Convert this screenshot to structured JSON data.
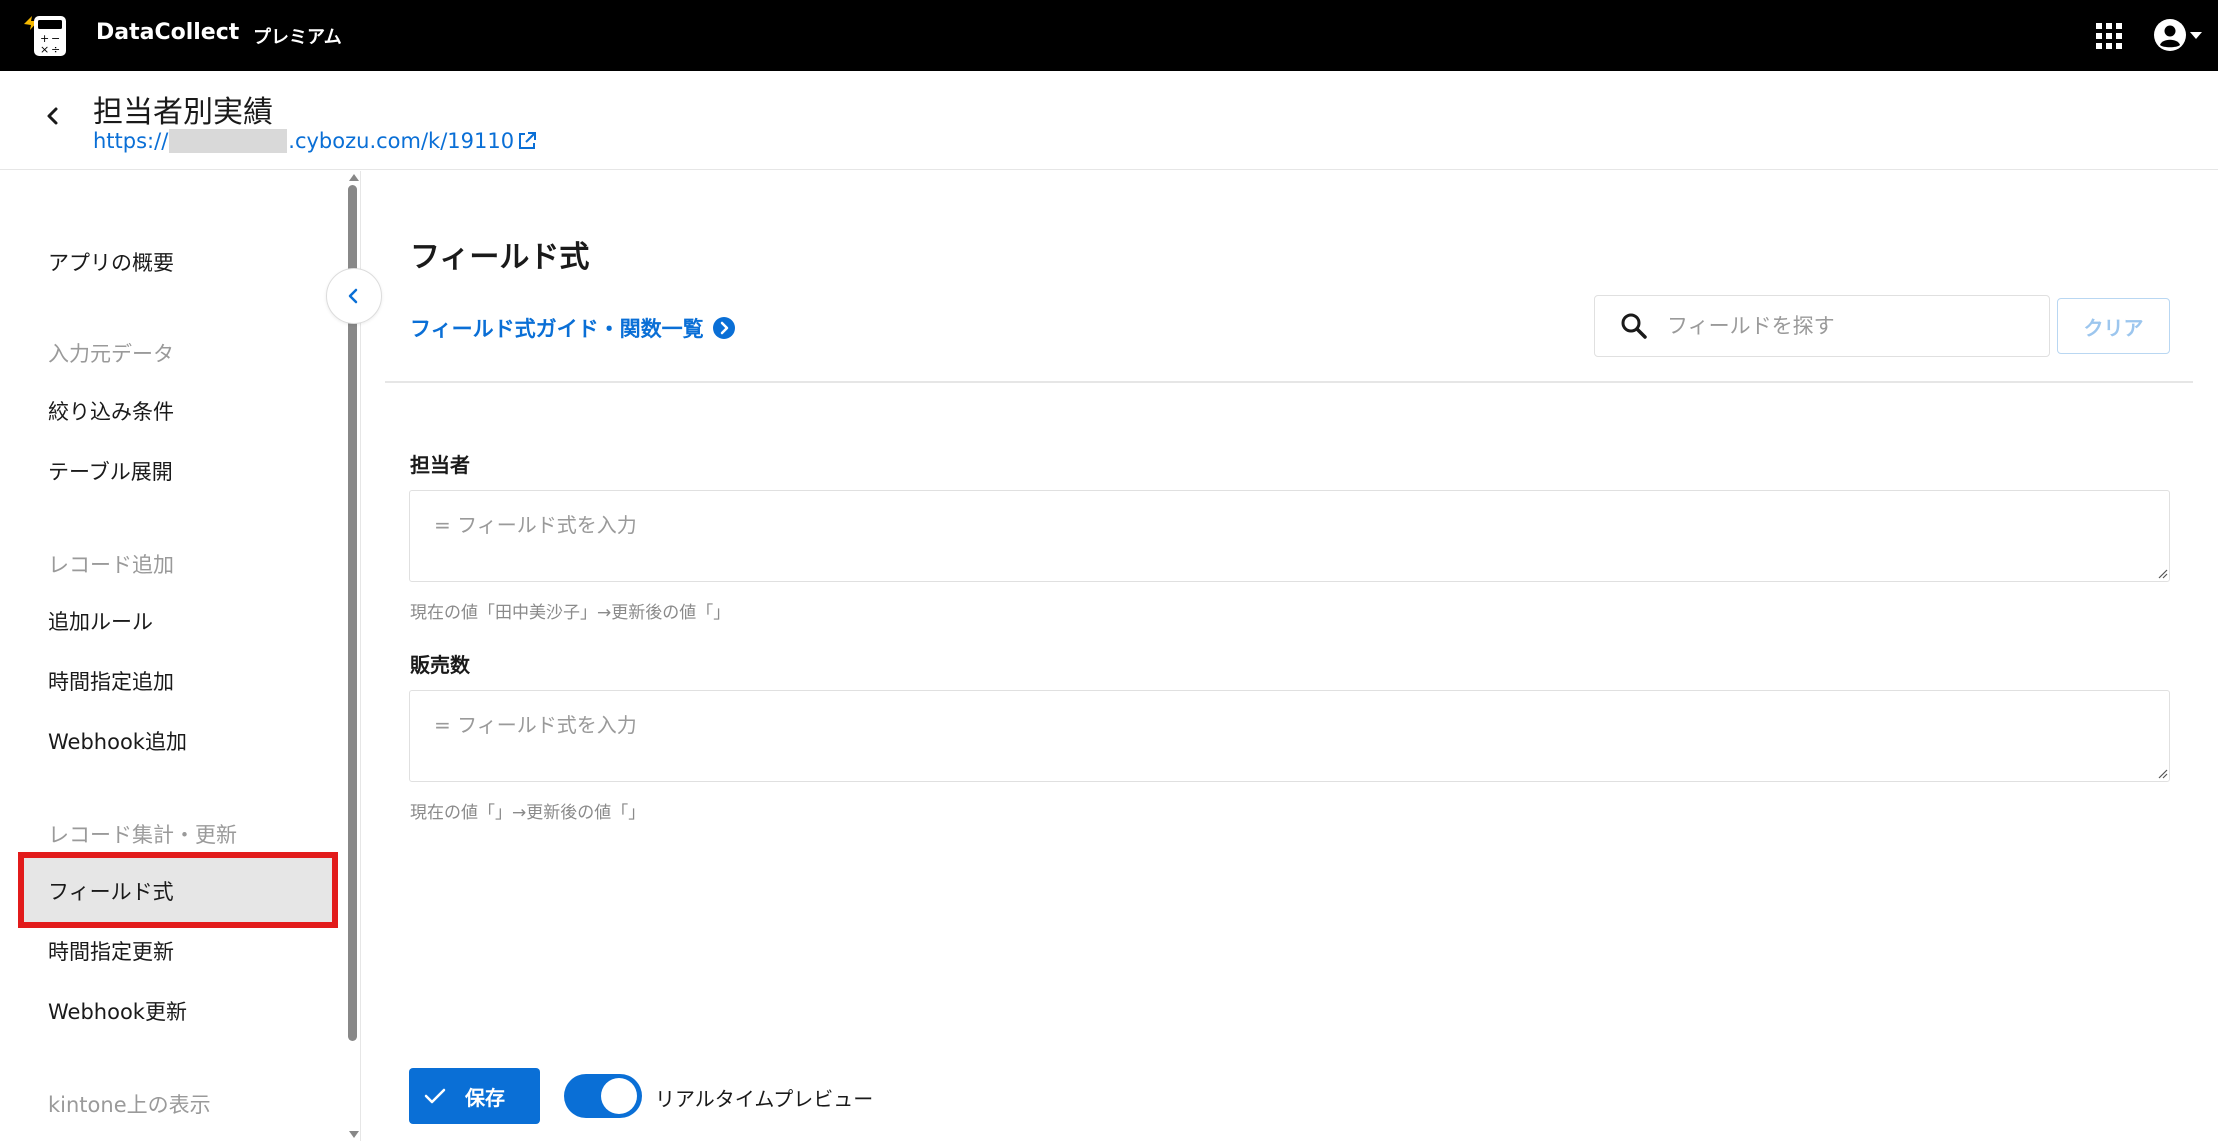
{
  "topbar": {
    "brand": "DataCollect",
    "plan": "プレミアム",
    "apps_icon": "grid-apps-icon",
    "user_icon": "account-circle-icon",
    "colors": {
      "background": "#000000",
      "text": "#ffffff"
    }
  },
  "header": {
    "title": "担当者別実績",
    "url_prefix": "https://",
    "url_suffix": ".cybozu.com/k/19110",
    "back_icon": "chevron-left-icon",
    "external_icon": "external-link-icon"
  },
  "sidebar": {
    "items": [
      {
        "type": "item",
        "label": "アプリの概要"
      },
      {
        "type": "section",
        "label": "入力元データ"
      },
      {
        "type": "item",
        "label": "絞り込み条件"
      },
      {
        "type": "item",
        "label": "テーブル展開"
      },
      {
        "type": "section",
        "label": "レコード追加"
      },
      {
        "type": "item",
        "label": "追加ルール"
      },
      {
        "type": "item",
        "label": "時間指定追加"
      },
      {
        "type": "item",
        "label": "Webhook追加"
      },
      {
        "type": "section",
        "label": "レコード集計・更新"
      },
      {
        "type": "item",
        "label": "フィールド式",
        "active": true
      },
      {
        "type": "item",
        "label": "時間指定更新"
      },
      {
        "type": "item",
        "label": "Webhook更新"
      },
      {
        "type": "section",
        "label": "kintone上の表示"
      }
    ],
    "highlight_color": "#e21b1b"
  },
  "main": {
    "title": "フィールド式",
    "guide_link": "フィールド式ガイド・関数一覧",
    "search": {
      "placeholder": "フィールドを探す",
      "value": ""
    },
    "clear_label": "クリア",
    "fields": [
      {
        "label": "担当者",
        "placeholder": "= フィールド式を入力",
        "preview": "現在の値「田中美沙子」→更新後の値「」"
      },
      {
        "label": "販売数",
        "placeholder": "= フィールド式を入力",
        "preview": "現在の値「」→更新後の値「」"
      }
    ],
    "save_label": "保存",
    "realtime_preview_label": "リアルタイムプレビュー",
    "realtime_preview_on": true,
    "accent_color": "#0a6fd6"
  }
}
